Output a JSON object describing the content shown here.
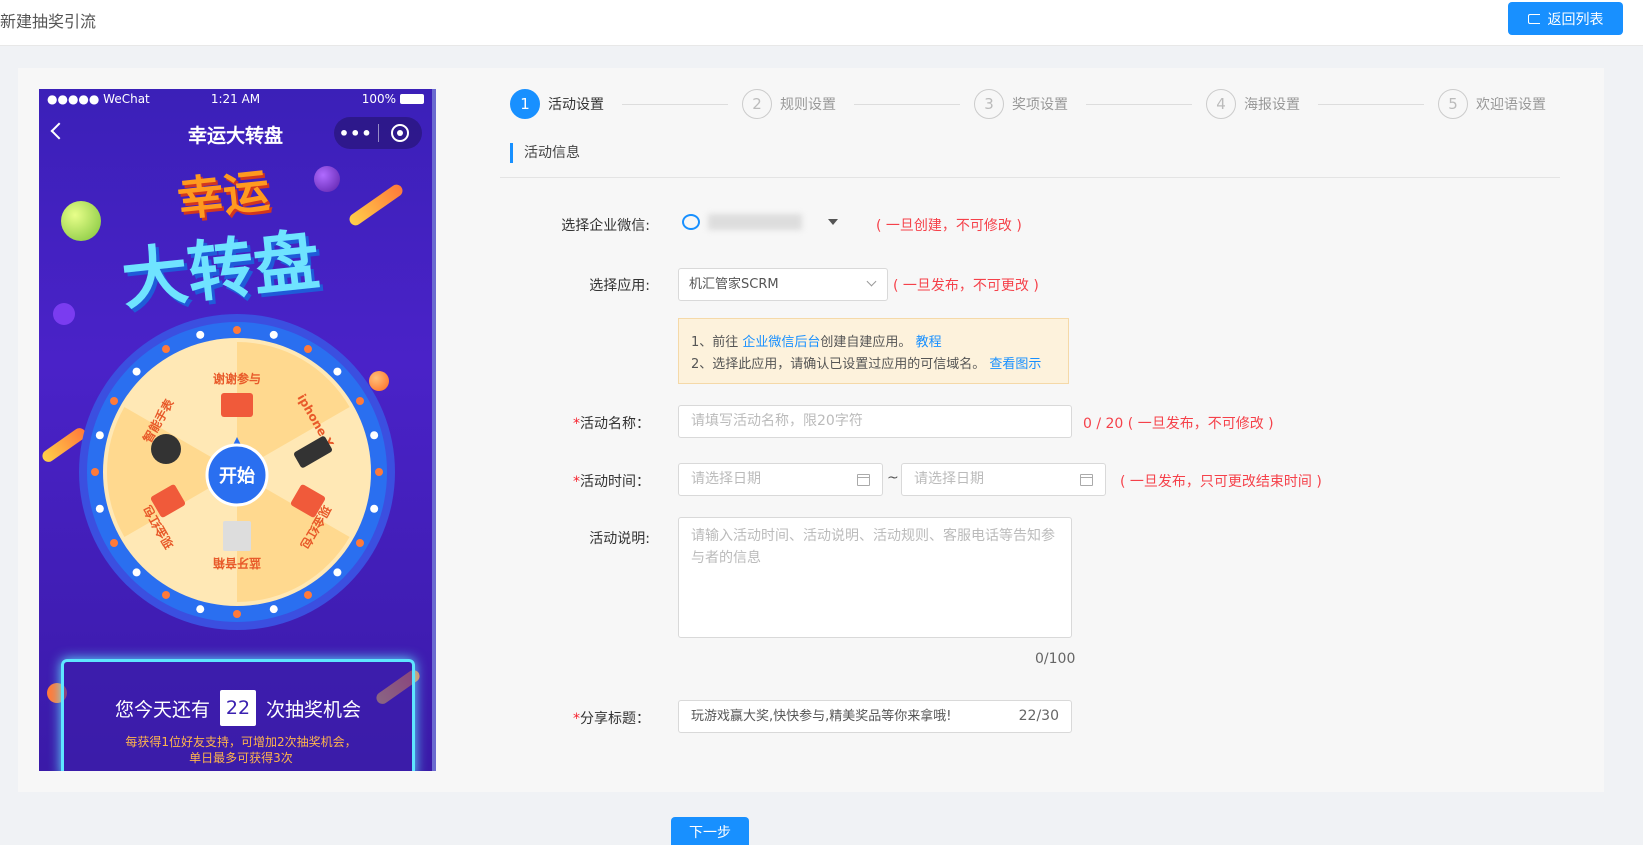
{
  "header": {
    "title": "新建抽奖引流",
    "back_label": "返回列表"
  },
  "phone": {
    "carrier": "●●●●● WeChat",
    "time": "1:21 AM",
    "battery": "100%",
    "nav_title": "幸运大转盘",
    "hero_line1": "幸运",
    "hero_line2": "大转盘",
    "wheel_segments": [
      "谢谢参与",
      "iphone X",
      "现金红包",
      "蓝牙音箱",
      "现金红包",
      "智能手表"
    ],
    "start_label": "开始",
    "chance_prefix": "您今天还有",
    "chance_count": "22",
    "chance_suffix": "次抽奖机会",
    "chance_note": "每获得1位好友支持，可增加2次抽奖机会，单日最多可获得3次"
  },
  "steps": [
    {
      "num": "1",
      "label": "活动设置"
    },
    {
      "num": "2",
      "label": "规则设置"
    },
    {
      "num": "3",
      "label": "奖项设置"
    },
    {
      "num": "4",
      "label": "海报设置"
    },
    {
      "num": "5",
      "label": "欢迎语设置"
    }
  ],
  "section_title": "活动信息",
  "form": {
    "corp": {
      "label": "选择企业微信:",
      "hint": "( 一旦创建，不可修改 )"
    },
    "app": {
      "label": "选择应用:",
      "value": "机汇管家SCRM",
      "hint": "( 一旦发布，不可更改 )"
    },
    "notice": {
      "line1_prefix": "1、前往 ",
      "line1_link": "企业微信后台",
      "line1_mid": "创建自建应用。 ",
      "line1_link2": "教程",
      "line2_prefix": "2、选择此应用，请确认已设置过应用的可信域名。 ",
      "line2_link": "查看图示"
    },
    "name": {
      "required": "*",
      "label": "活动名称：",
      "placeholder": "请填写活动名称，限20字符",
      "hint": "0 / 20 ( 一旦发布，不可修改 )"
    },
    "time": {
      "required": "*",
      "label": "活动时间：",
      "start_placeholder": "请选择日期",
      "end_placeholder": "请选择日期",
      "separator": "~",
      "hint": "( 一旦发布，只可更改结束时间 )"
    },
    "desc": {
      "label": "活动说明:",
      "placeholder": "请输入活动时间、活动说明、活动规则、客服电话等告知参与者的信息",
      "counter": "0/100"
    },
    "share": {
      "required": "*",
      "label": "分享标题：",
      "value": "玩游戏赢大奖,快快参与,精美奖品等你来拿哦!",
      "counter": "22/30"
    }
  },
  "next_label": "下一步",
  "colors": {
    "primary": "#1890ff",
    "danger": "#f5222d",
    "notice_bg": "#fdf2dc"
  }
}
